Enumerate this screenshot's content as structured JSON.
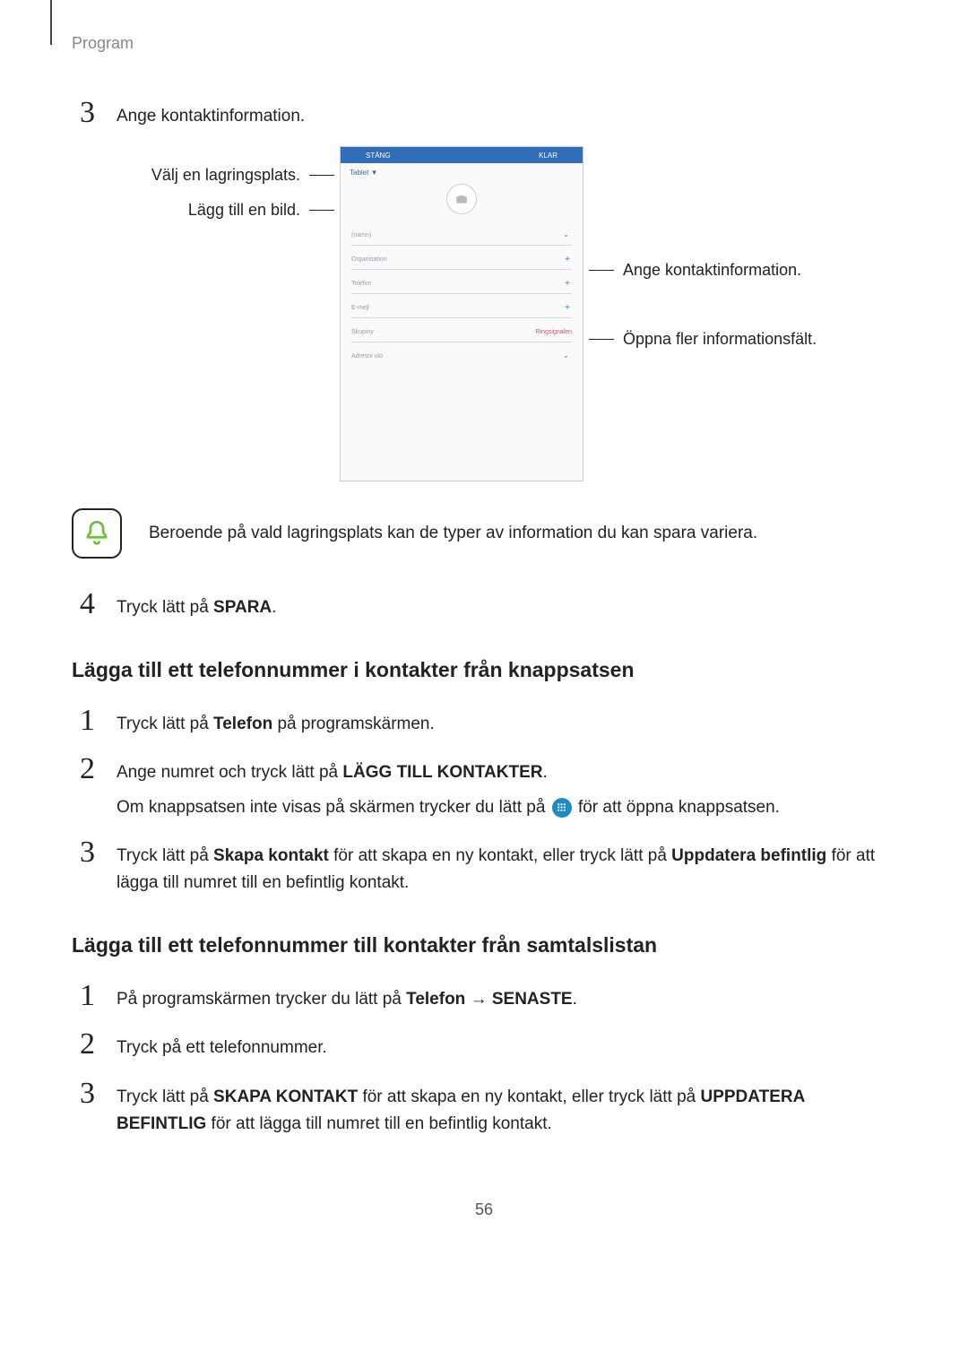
{
  "header": {
    "category": "Program"
  },
  "step3": {
    "num": "3",
    "text": "Ange kontaktinformation."
  },
  "figure": {
    "left": {
      "storage": "Välj en lagringsplats.",
      "image": "Lägg till en bild."
    },
    "right": {
      "info": "Ange kontaktinformation.",
      "more": "Öppna fler informationsfält."
    },
    "mock": {
      "top_left": "STÄNG",
      "top_right": "KLAR",
      "storage_select": "Tablet ▼",
      "fields": [
        "(namn)",
        "Organisation",
        "Telefon",
        "E-mejl",
        "Skupiny",
        "Adresni ulo"
      ],
      "ringsignal": "Ringsignalen"
    }
  },
  "note": {
    "text": "Beroende på vald lagringsplats kan de typer av information du kan spara variera."
  },
  "step4": {
    "num": "4",
    "pre": "Tryck lätt på ",
    "bold": "SPARA",
    "post": "."
  },
  "subhead1": "Lägga till ett telefonnummer i kontakter från knappsatsen",
  "k1": {
    "num": "1",
    "pre": "Tryck lätt på ",
    "bold": "Telefon",
    "post": " på programskärmen."
  },
  "k2": {
    "num": "2",
    "l1_pre": "Ange numret och tryck lätt på ",
    "l1_bold": "LÄGG TILL KONTAKTER",
    "l1_post": ".",
    "l2_pre": "Om knappsatsen inte visas på skärmen trycker du lätt på ",
    "l2_post": " för att öppna knappsatsen."
  },
  "k3": {
    "num": "3",
    "pre": "Tryck lätt på ",
    "b1": "Skapa kontakt",
    "mid": " för att skapa en ny kontakt, eller tryck lätt på ",
    "b2": "Uppdatera befintlig",
    "post": " för att lägga till numret till en befintlig kontakt."
  },
  "subhead2": "Lägga till ett telefonnummer till kontakter från samtalslistan",
  "s1": {
    "num": "1",
    "pre": "På programskärmen trycker du lätt på ",
    "b1": "Telefon",
    "arrow": " → ",
    "b2": "SENASTE",
    "post": "."
  },
  "s2": {
    "num": "2",
    "text": "Tryck på ett telefonnummer."
  },
  "s3": {
    "num": "3",
    "pre": "Tryck lätt på ",
    "b1": "SKAPA KONTAKT",
    "mid": " för att skapa en ny kontakt, eller tryck lätt på ",
    "b2": "UPPDATERA BEFINTLIG",
    "post": " för att lägga till numret till en befintlig kontakt."
  },
  "pagenum": "56"
}
